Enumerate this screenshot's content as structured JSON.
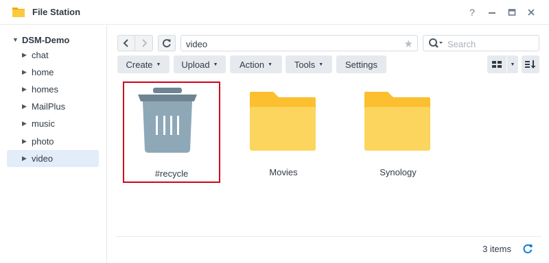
{
  "window": {
    "title": "File Station",
    "help_glyph": "?",
    "minimize_glyph": "—",
    "maximize_glyph": "▭",
    "close_glyph": "✕"
  },
  "sidebar": {
    "root_label": "DSM-Demo",
    "items": [
      {
        "label": "chat",
        "selected": false
      },
      {
        "label": "home",
        "selected": false
      },
      {
        "label": "homes",
        "selected": false
      },
      {
        "label": "MailPlus",
        "selected": false
      },
      {
        "label": "music",
        "selected": false
      },
      {
        "label": "photo",
        "selected": false
      },
      {
        "label": "video",
        "selected": true
      }
    ]
  },
  "navbar": {
    "path": "video",
    "search_placeholder": "Search"
  },
  "toolbar": {
    "create_label": "Create",
    "upload_label": "Upload",
    "action_label": "Action",
    "tools_label": "Tools",
    "settings_label": "Settings"
  },
  "files": [
    {
      "name": "#recycle",
      "type": "recycle-bin",
      "selected": true
    },
    {
      "name": "Movies",
      "type": "folder",
      "selected": false
    },
    {
      "name": "Synology",
      "type": "folder",
      "selected": false
    }
  ],
  "status": {
    "item_count": "3 items"
  },
  "colors": {
    "folder": "#fcd55e",
    "folder_tab": "#fbbf30",
    "trash": "#8ea8b8",
    "trash_lid": "#6e8493",
    "accent": "#0a7ad4",
    "selection_border": "#d0021b",
    "selected_row": "#e2edf9"
  }
}
